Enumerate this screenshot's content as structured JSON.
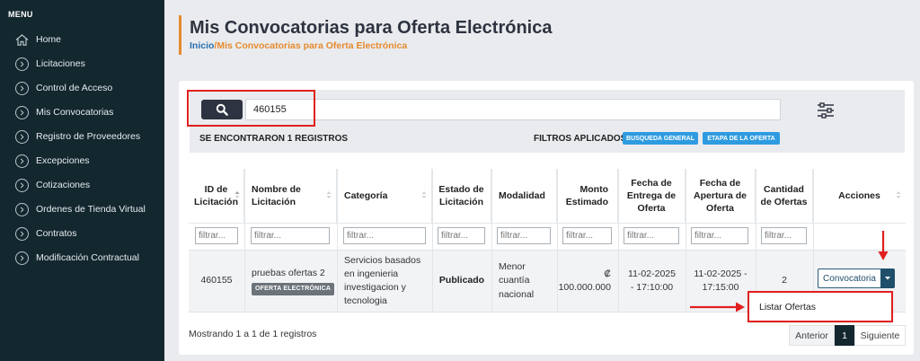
{
  "sidebar": {
    "menu_title": "MENU",
    "items": [
      {
        "label": "Home",
        "icon": "home-icon"
      },
      {
        "label": "Licitaciones",
        "icon": "chevron-right-icon"
      },
      {
        "label": "Control de Acceso",
        "icon": "chevron-right-icon"
      },
      {
        "label": "Mis Convocatorias",
        "icon": "chevron-right-icon"
      },
      {
        "label": "Registro de Proveedores",
        "icon": "chevron-right-icon"
      },
      {
        "label": "Excepciones",
        "icon": "chevron-right-icon"
      },
      {
        "label": "Cotizaciones",
        "icon": "chevron-right-icon"
      },
      {
        "label": "Ordenes de Tienda Virtual",
        "icon": "chevron-right-icon"
      },
      {
        "label": "Contratos",
        "icon": "chevron-right-icon"
      },
      {
        "label": "Modificación Contractual",
        "icon": "chevron-right-icon"
      }
    ]
  },
  "header": {
    "title": "Mis Convocatorias para Oferta Electrónica",
    "breadcrumb_home": "Inicio",
    "breadcrumb_sep": "/",
    "breadcrumb_current": "Mis Convocatorias para Oferta Electrónica"
  },
  "search": {
    "value": "460155",
    "records_found": "SE ENCONTRARON 1 REGISTROS",
    "filters_label": "FILTROS APLICADOS:",
    "chips": [
      "BUSQUEDA GENERAL",
      "ETAPA DE LA OFERTA"
    ]
  },
  "table": {
    "headers": [
      "ID de Licitación",
      "Nombre de Licitación",
      "Categoría",
      "Estado de Licitación",
      "Modalidad",
      "Monto Estimado",
      "Fecha de Entrega de Oferta",
      "Fecha de Apertura de Oferta",
      "Cantidad de Ofertas",
      "Acciones"
    ],
    "filter_placeholder": "filtrar...",
    "row": {
      "id": "460155",
      "name": "pruebas ofertas 2",
      "badge": "OFERTA ELECTRÓNICA",
      "category": "Servicios basados en ingenieria investigacion y tecnologia",
      "status": "Publicado",
      "modality": "Menor cuantía nacional",
      "amount": "₡ 100.000.000",
      "delivery_date": "11-02-2025 - 17:10:00",
      "opening_date": "11-02-2025 - 17:15:00",
      "offers_count": "2",
      "action_button": "Convocatoria",
      "dropdown_item": "Listar Ofertas"
    }
  },
  "footer": {
    "info": "Mostrando 1 a 1 de 1 registros",
    "prev": "Anterior",
    "page": "1",
    "next": "Siguiente"
  },
  "colors": {
    "sidebar_bg": "#13272f",
    "accent_orange": "#e68a2e",
    "chip_blue": "#2e9be0",
    "annotation_red": "#e0201f"
  }
}
